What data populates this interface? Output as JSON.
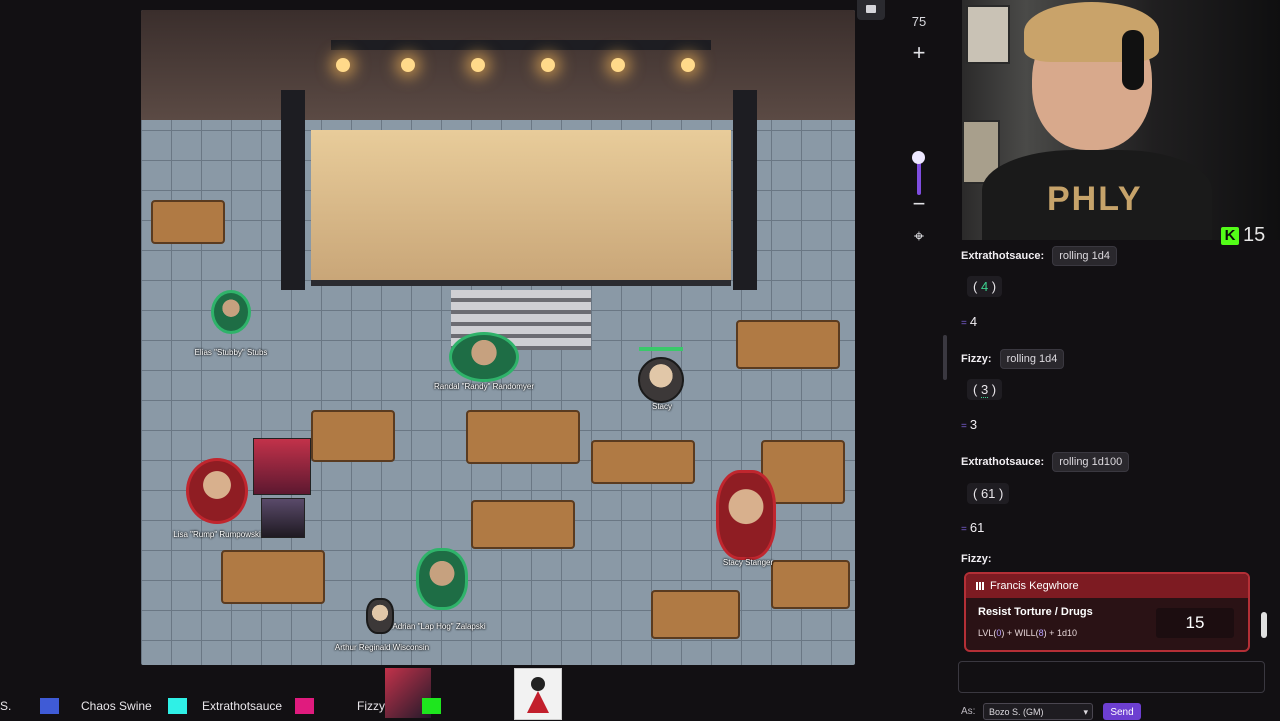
{
  "map": {
    "zoom_level": "75",
    "zoom_in_label": "+",
    "zoom_out_label": "−",
    "recenter_label": "⌖",
    "tokens": [
      {
        "name": "Elias \"Stubby\" Stubs"
      },
      {
        "name": "Randal \"Randy\" Randomyer"
      },
      {
        "name": "Stacy"
      },
      {
        "name": "Lisa \"Rump\" Rumpowski"
      },
      {
        "name": "Stacy Stanger"
      },
      {
        "name": "Adrian \"Lap Hog\" Zalapski"
      },
      {
        "name": "Arthur Reginald Wisconsin"
      }
    ]
  },
  "stream": {
    "kick_viewers": "15",
    "kick_icon": "K"
  },
  "chat": {
    "messages": [
      {
        "author": "Extrathotsauce:",
        "roll": "rolling 1d4",
        "dice": "4",
        "total": "4"
      },
      {
        "author": "Fizzy:",
        "roll": "rolling 1d4",
        "dice": "3",
        "total": "3"
      },
      {
        "author": "Extrathotsauce:",
        "roll": "rolling 1d100",
        "dice": "61",
        "total": "61"
      }
    ],
    "last_author": "Fizzy:",
    "card": {
      "character": "Francis Kegwhore",
      "skill": "Resist Torture / Drugs",
      "formula_lvl_label": "LVL",
      "formula_lvl": "0",
      "formula_will_label": "WILL",
      "formula_will": "8",
      "formula_die": "1d10",
      "result": "15"
    },
    "as_label": "As:",
    "as_value": "Bozo S. (GM)",
    "send_label": "Send"
  },
  "players": {
    "items": [
      {
        "name": "S.",
        "color": "#3f5bd6"
      },
      {
        "name": "Chaos Swine",
        "color": "#2ff0e6"
      },
      {
        "name": "Extrathotsauce",
        "color": "#e01b7e"
      },
      {
        "name": "Fizzy",
        "color": "#1ee61e"
      }
    ]
  }
}
